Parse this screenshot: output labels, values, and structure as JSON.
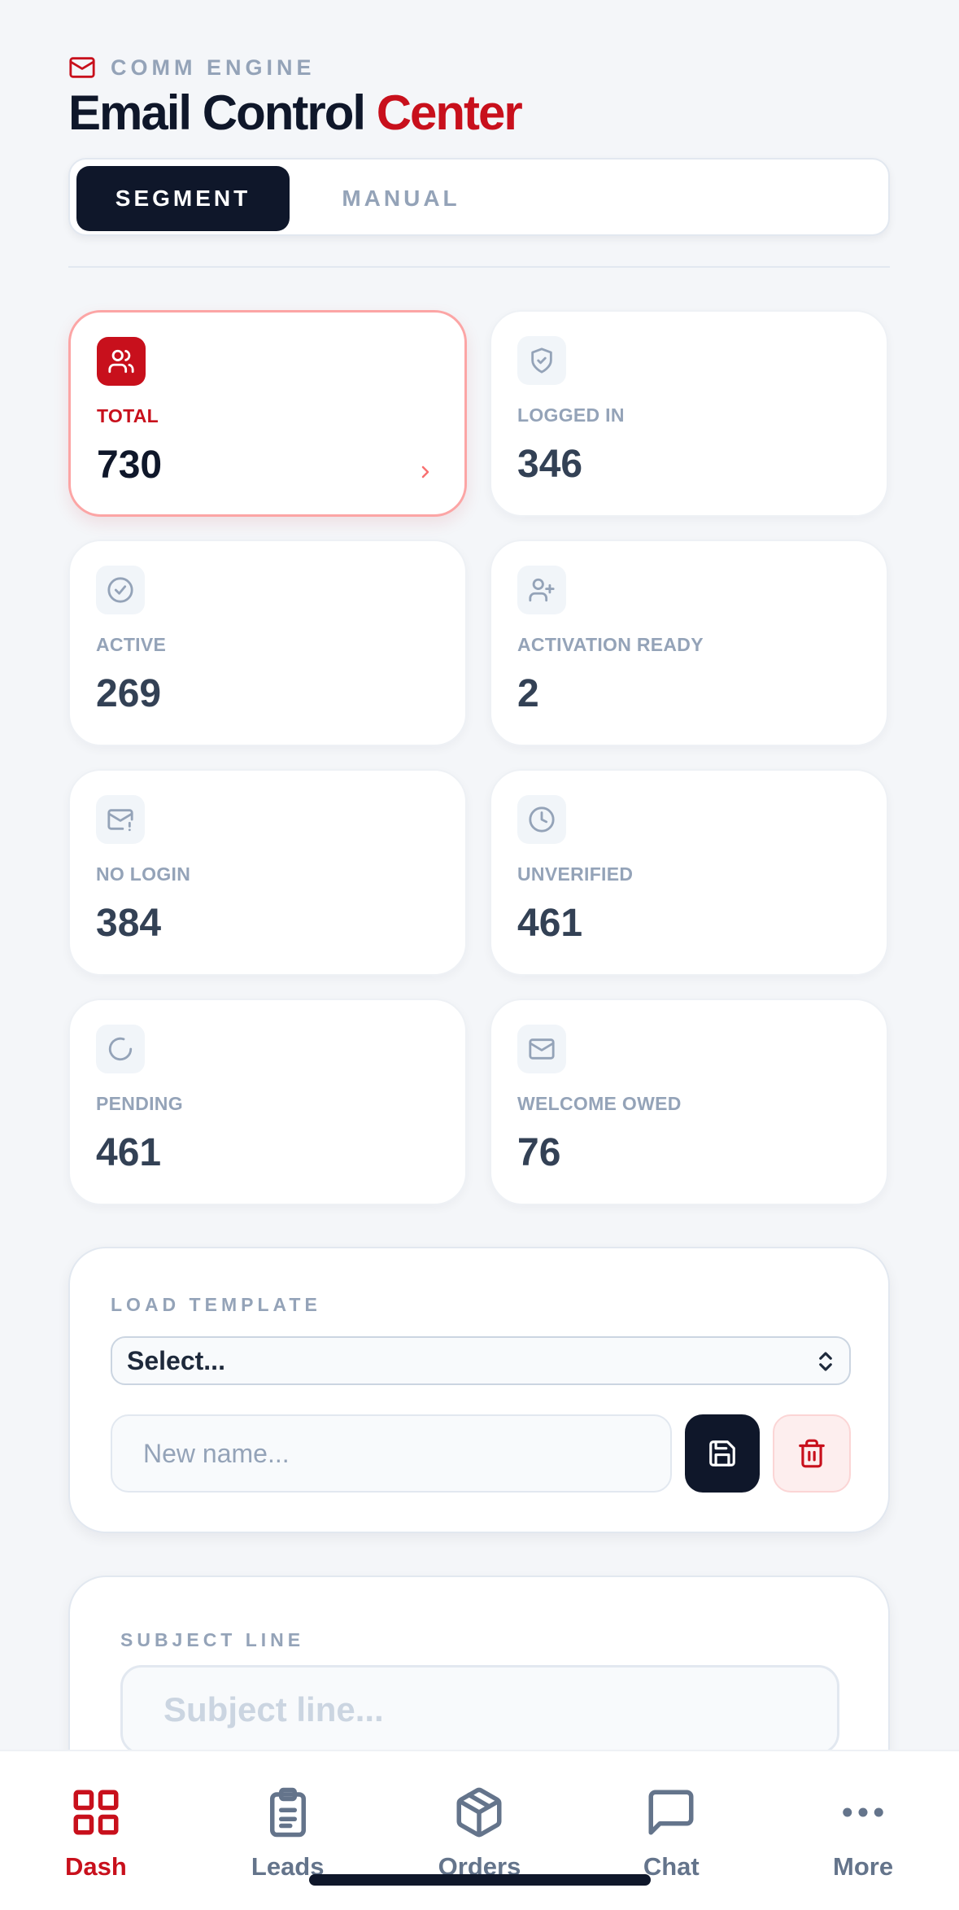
{
  "header": {
    "eyebrow": "COMM ENGINE",
    "title_main": "Email Control",
    "title_accent": "Center"
  },
  "tabs": [
    {
      "label": "SEGMENT",
      "active": true
    },
    {
      "label": "MANUAL",
      "active": false
    }
  ],
  "stats": [
    {
      "label": "TOTAL",
      "value": "730",
      "icon": "users-icon",
      "selected": true
    },
    {
      "label": "LOGGED IN",
      "value": "346",
      "icon": "shield-check-icon"
    },
    {
      "label": "ACTIVE",
      "value": "269",
      "icon": "check-circle-icon"
    },
    {
      "label": "ACTIVATION READY",
      "value": "2",
      "icon": "user-plus-icon"
    },
    {
      "label": "NO LOGIN",
      "value": "384",
      "icon": "mail-alert-icon"
    },
    {
      "label": "UNVERIFIED",
      "value": "461",
      "icon": "clock-icon"
    },
    {
      "label": "PENDING",
      "value": "461",
      "icon": "loader-icon"
    },
    {
      "label": "WELCOME OWED",
      "value": "76",
      "icon": "mail-icon"
    }
  ],
  "template": {
    "label": "LOAD TEMPLATE",
    "select_value": "Select...",
    "new_name_placeholder": "New name..."
  },
  "subject": {
    "label": "SUBJECT LINE",
    "placeholder": "Subject line..."
  },
  "nav": [
    {
      "label": "Dash",
      "icon": "grid-icon",
      "active": true
    },
    {
      "label": "Leads",
      "icon": "clipboard-icon"
    },
    {
      "label": "Orders",
      "icon": "package-icon"
    },
    {
      "label": "Chat",
      "icon": "chat-icon"
    },
    {
      "label": "More",
      "icon": "more-icon"
    }
  ],
  "colors": {
    "accent": "#c8101c",
    "dark": "#0f172a",
    "muted": "#94a3b8",
    "background": "#f4f6f9"
  }
}
